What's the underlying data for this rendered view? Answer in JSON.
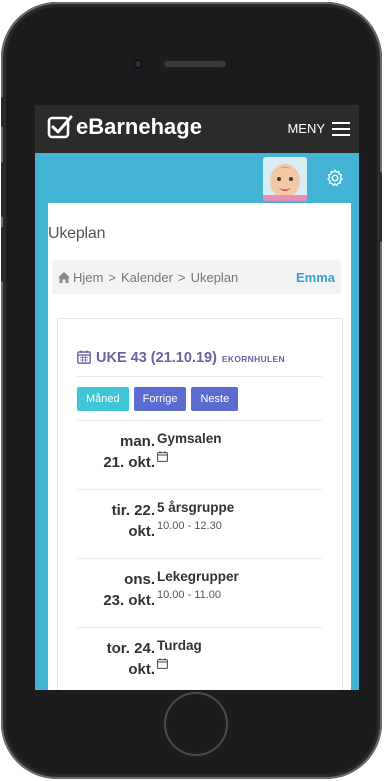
{
  "app": {
    "brand": "eBarnehage",
    "menu_label": "MENY"
  },
  "page": {
    "title": "Ukeplan"
  },
  "breadcrumb": {
    "home": "Hjem",
    "separator": ">",
    "level2": "Kalender",
    "level3": "Ukeplan",
    "child": "Emma"
  },
  "week": {
    "title": "UKE 43 (21.10.19)",
    "group": "EKORNHULEN"
  },
  "buttons": {
    "month": "Måned",
    "prev": "Forrige",
    "next": "Neste"
  },
  "days": [
    {
      "day": "man.",
      "date": "21. okt.",
      "title": "Gymsalen",
      "time": "",
      "icon": "calendar-icon"
    },
    {
      "day": "tir. 22.",
      "date": "okt.",
      "title": "5 årsgruppe",
      "time": "10.00 - 12.30",
      "icon": ""
    },
    {
      "day": "ons.",
      "date": "23. okt.",
      "title": "Lekegrupper",
      "time": "10.00 - 11.00",
      "icon": ""
    },
    {
      "day": "tor. 24.",
      "date": "okt.",
      "title": "Turdag",
      "time": "",
      "icon": "calendar-icon"
    }
  ],
  "colors": {
    "topbar": "#2b2b2b",
    "accent_blue": "#44b4d6",
    "purple": "#6f5fa3",
    "btn_month": "#3fc6d6",
    "btn_nav": "#5b6bd0"
  }
}
